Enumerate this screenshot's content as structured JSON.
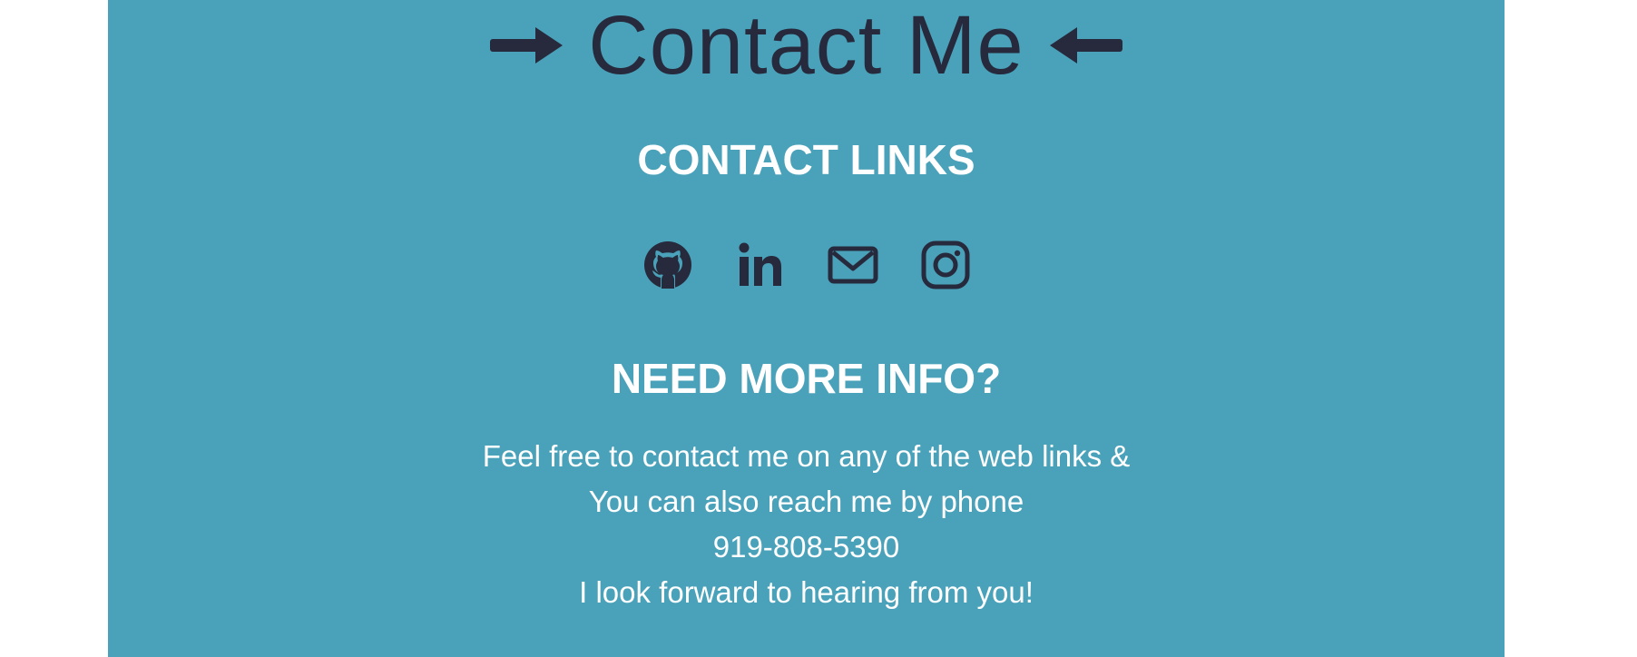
{
  "page": {
    "title": "Contact Me"
  },
  "contact_links": {
    "heading": "CONTACT LINKS",
    "icons": [
      "github-icon",
      "linkedin-icon",
      "envelope-icon",
      "instagram-icon"
    ]
  },
  "more_info": {
    "heading": "NEED MORE INFO?",
    "lines": [
      "Feel free to contact me on any of the web links &",
      "You can also reach me by phone",
      "919-808-5390",
      "I look forward to hearing from you!"
    ]
  },
  "colors": {
    "panel_background": "#4aa2ba",
    "dark_text": "#262a3c",
    "light_text": "#ffffff",
    "page_background": "#ffffff"
  }
}
